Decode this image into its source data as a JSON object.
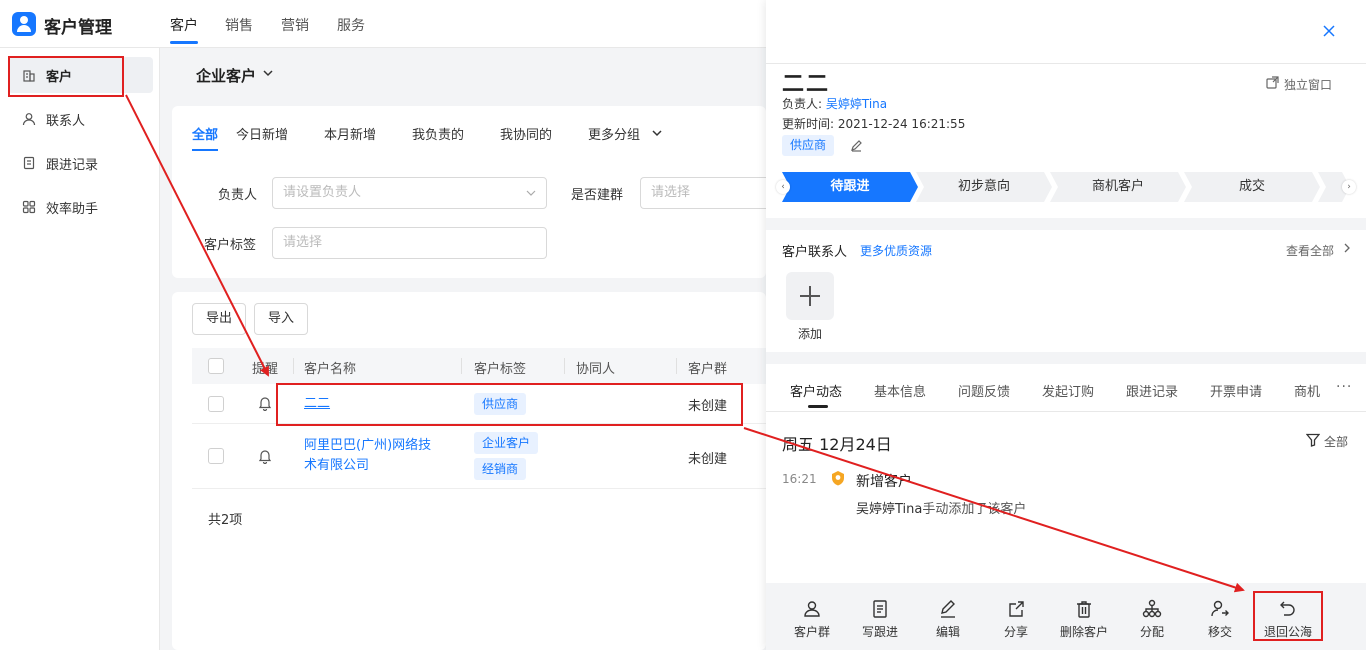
{
  "app": {
    "title": "客户管理"
  },
  "top_nav": [
    {
      "label": "客户",
      "active": true
    },
    {
      "label": "销售"
    },
    {
      "label": "营销"
    },
    {
      "label": "服务"
    }
  ],
  "sidebar": {
    "items": [
      {
        "label": "客户",
        "icon": "building-icon",
        "active": true
      },
      {
        "label": "联系人",
        "icon": "person-icon"
      },
      {
        "label": "跟进记录",
        "icon": "clipboard-icon"
      },
      {
        "label": "效率助手",
        "icon": "grid-icon"
      }
    ]
  },
  "main": {
    "title": "企业客户",
    "filter_tabs": [
      "全部",
      "今日新增",
      "本月新增",
      "我负责的",
      "我协同的",
      "更多分组"
    ],
    "filters": {
      "owner": {
        "label": "负责人",
        "placeholder": "请设置负责人"
      },
      "group": {
        "label": "是否建群",
        "placeholder": "请选择"
      },
      "tags": {
        "label": "客户标签",
        "placeholder": "请选择"
      }
    },
    "buttons": {
      "export": "导出",
      "import": "导入"
    },
    "columns": [
      "提醒",
      "客户名称",
      "客户标签",
      "协同人",
      "客户群"
    ],
    "rows": [
      {
        "name": "二二",
        "tags": [
          "供应商"
        ],
        "group": "未创建"
      },
      {
        "name_line1": "阿里巴巴(广州)网络技",
        "name_line2": "术有限公司",
        "tags": [
          "企业客户",
          "经销商"
        ],
        "group": "未创建"
      }
    ],
    "total": "共2项"
  },
  "drawer": {
    "name": "二二",
    "pop_out": "独立窗口",
    "owner_label": "负责人:",
    "owner": "吴婷婷Tina",
    "updated_label": "更新时间:",
    "updated": "2021-12-24 16:21:55",
    "tag": "供应商",
    "stages": [
      "待跟进",
      "初步意向",
      "商机客户",
      "成交"
    ],
    "contacts_title": "客户联系人",
    "contacts_link": "更多优质资源",
    "view_all": "查看全部",
    "add_label": "添加",
    "tabs": [
      "客户动态",
      "基本信息",
      "问题反馈",
      "发起订购",
      "跟进记录",
      "开票申请",
      "商机"
    ],
    "more": "···",
    "date": "周五 12月24日",
    "filter_all": "全部",
    "timeline": {
      "time": "16:21",
      "title": "新增客户",
      "who": "吴婷婷Tina",
      "desc": "手动添加了该客户"
    },
    "actions": [
      {
        "label": "客户群",
        "icon": "user-group-icon"
      },
      {
        "label": "写跟进",
        "icon": "document-icon"
      },
      {
        "label": "编辑",
        "icon": "pencil-icon"
      },
      {
        "label": "分享",
        "icon": "share-icon"
      },
      {
        "label": "删除客户",
        "icon": "trash-icon"
      },
      {
        "label": "分配",
        "icon": "org-chart-icon"
      },
      {
        "label": "移交",
        "icon": "transfer-icon"
      },
      {
        "label": "退回公海",
        "icon": "undo-icon"
      }
    ]
  },
  "colors": {
    "accent": "#1677ff",
    "annotation": "#e02020"
  }
}
